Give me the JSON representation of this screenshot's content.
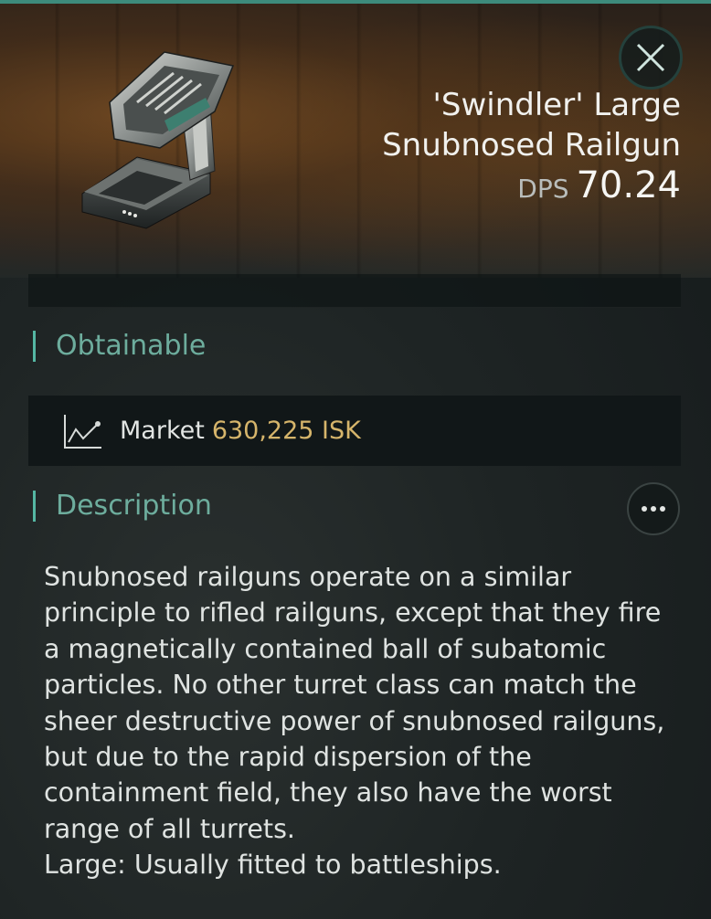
{
  "item": {
    "name": "'Swindler' Large Snubnosed Railgun",
    "dps_label": "DPS",
    "dps_value": "70.24"
  },
  "sections": {
    "obtainable": {
      "title": "Obtainable",
      "market_label": "Market",
      "market_price": "630,225 ISK"
    },
    "description": {
      "title": "Description",
      "body": "Snubnosed railguns operate on a similar principle to rifled railguns, except that they fire a magnetically contained ball of subatomic particles. No other turret class can match the sheer destructive power of snubnosed railguns, but due to the rapid dispersion of the containment field, they also have the worst range of all turrets.",
      "footnote": "Large: Usually fitted to battleships."
    }
  },
  "icons": {
    "close": "close-icon",
    "market": "market-chart-icon",
    "more": "more-options-icon",
    "item": "railgun-turret-image"
  },
  "colors": {
    "accent": "#55b7a3",
    "section_title": "#6dad9d",
    "price": "#d6b56b"
  }
}
